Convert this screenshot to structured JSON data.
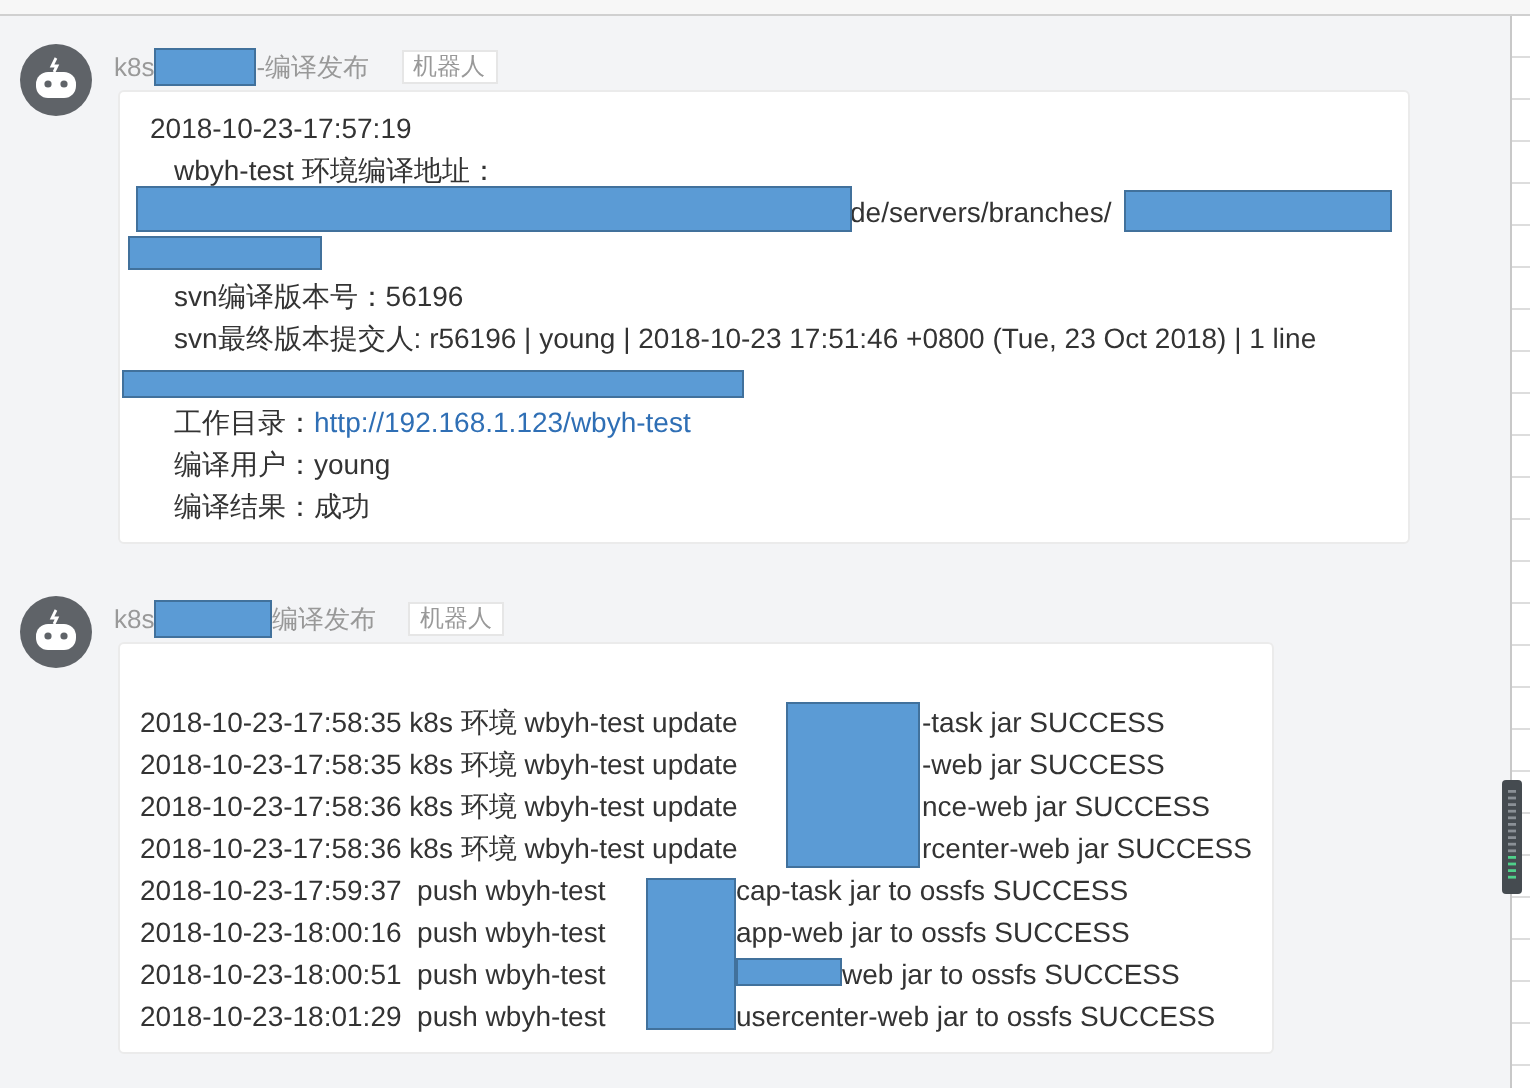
{
  "messages": [
    {
      "sender_prefix": "k8s",
      "sender_suffix": "-编译发布",
      "badge": "机器人",
      "lines": [
        {
          "kind": "timestamp",
          "text": "2018-10-23-17:57:19"
        },
        {
          "kind": "text",
          "text": "wbyh-test 环境编译地址："
        },
        {
          "kind": "tail",
          "text": "de/servers/branches/"
        },
        {
          "kind": "text",
          "text": "svn编译版本号：56196"
        },
        {
          "kind": "commit",
          "text": "svn最终版本提交人: r56196 | young | 2018-10-23 17:51:46 +0800 (Tue, 23 Oct 2018) | 1 line"
        },
        {
          "kind": "link",
          "label": "工作目录：",
          "url": "http://192.168.1.123/wbyh-test"
        },
        {
          "kind": "text",
          "text": "编译用户：young"
        },
        {
          "kind": "text",
          "text": "编译结果：成功"
        }
      ]
    },
    {
      "sender_prefix": "k8s",
      "sender_suffix": "编译发布",
      "badge": "机器人",
      "lines": [
        {
          "kind": "log",
          "text": "2018-10-23-17:58:35 k8s 环境 wbyh-test update",
          "tail": "-task jar SUCCESS"
        },
        {
          "kind": "log",
          "text": "2018-10-23-17:58:35 k8s 环境 wbyh-test update",
          "tail": "-web jar SUCCESS"
        },
        {
          "kind": "log",
          "text": "2018-10-23-17:58:36 k8s 环境 wbyh-test update",
          "tail": "nce-web jar SUCCESS"
        },
        {
          "kind": "log",
          "text": "2018-10-23-17:58:36 k8s 环境 wbyh-test update",
          "tail": "rcenter-web jar SUCCESS"
        },
        {
          "kind": "log",
          "text": "2018-10-23-17:59:37  push wbyh-test",
          "tail": "cap-task jar to ossfs SUCCESS"
        },
        {
          "kind": "log",
          "text": "2018-10-23-18:00:16  push wbyh-test",
          "tail": "app-web jar to ossfs SUCCESS"
        },
        {
          "kind": "log",
          "text": "2018-10-23-18:00:51  push wbyh-test",
          "tail": "web jar to ossfs SUCCESS"
        },
        {
          "kind": "log",
          "text": "2018-10-23-18:01:29  push wbyh-test",
          "tail": "usercenter-web jar to ossfs SUCCESS"
        }
      ]
    }
  ]
}
